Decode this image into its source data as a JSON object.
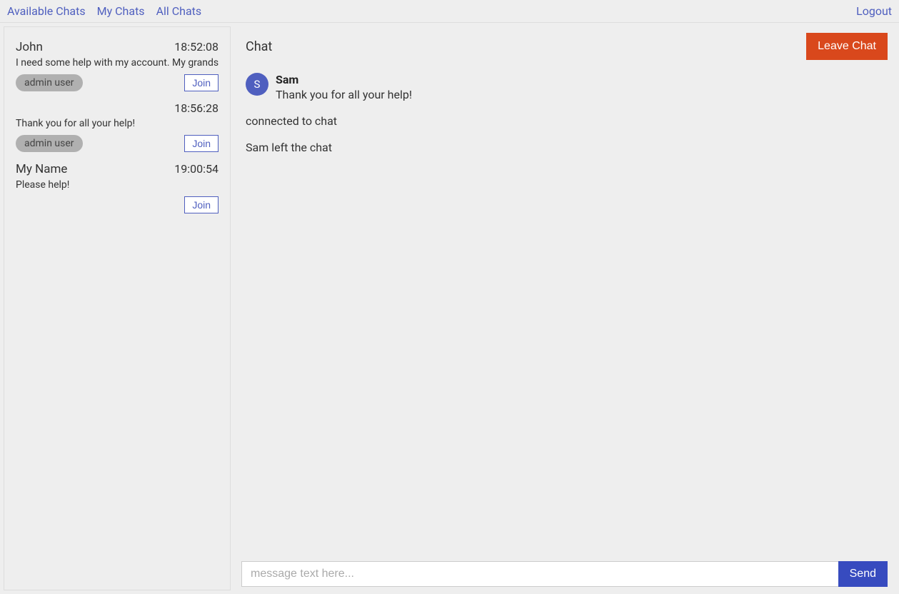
{
  "nav": {
    "available": "Available Chats",
    "my": "My Chats",
    "all": "All Chats",
    "logout": "Logout"
  },
  "sidebar": {
    "items": [
      {
        "name": "John",
        "time": "18:52:08",
        "preview": "I need some help with my account. My grandson",
        "badge": "admin user",
        "hasBadge": true,
        "join": "Join"
      },
      {
        "name": "",
        "time": "18:56:28",
        "preview": "Thank you for all your help!",
        "badge": "admin user",
        "hasBadge": true,
        "join": "Join"
      },
      {
        "name": "My Name",
        "time": "19:00:54",
        "preview": "Please help!",
        "badge": "",
        "hasBadge": false,
        "join": "Join"
      }
    ]
  },
  "chat": {
    "title": "Chat",
    "leave": "Leave Chat",
    "messages": [
      {
        "type": "user",
        "avatarLetter": "S",
        "sender": "Sam",
        "text": "Thank you for all your help!"
      },
      {
        "type": "system",
        "text": "connected to chat"
      },
      {
        "type": "system",
        "text": "Sam left the chat"
      }
    ],
    "composer": {
      "placeholder": "message text here...",
      "send": "Send"
    }
  }
}
